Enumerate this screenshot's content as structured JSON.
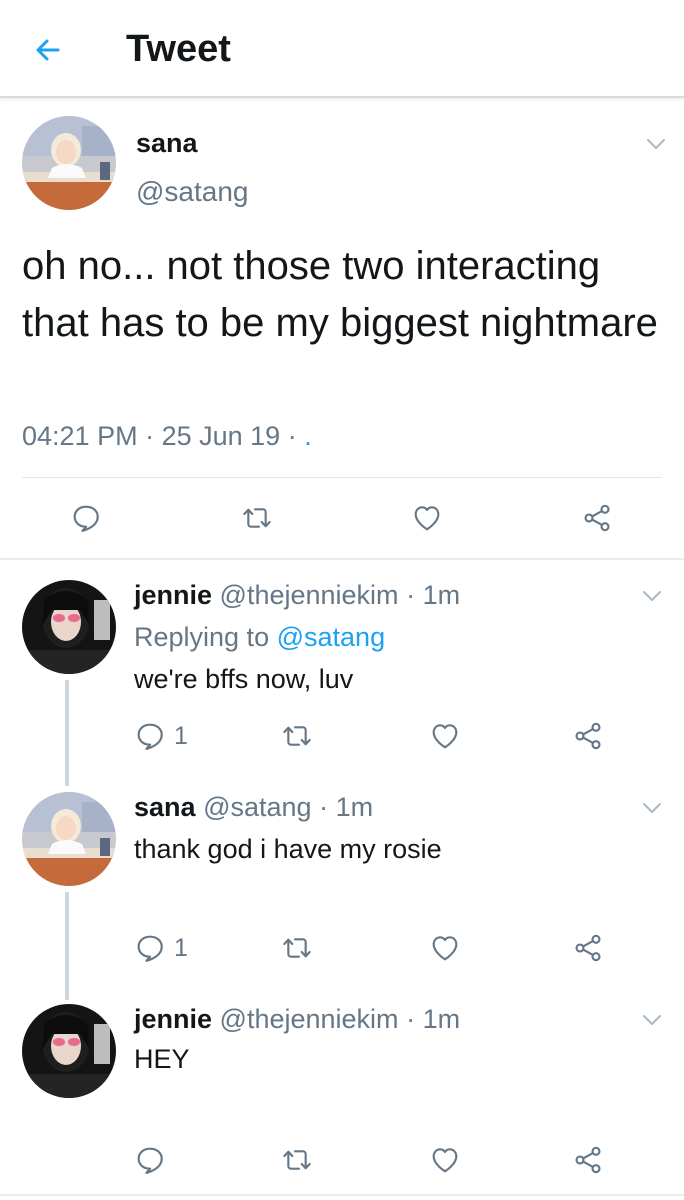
{
  "header": {
    "title": "Tweet"
  },
  "tweet": {
    "name": "sana",
    "handle": "@satang",
    "text": "oh no... not those two interacting that has to be my biggest nightmare",
    "time": "04:21 PM",
    "date": "25 Jun 19",
    "source_sep": "·",
    "source_dot": "."
  },
  "replies": [
    {
      "name": "jennie",
      "handle": "@thejenniekim",
      "time": "1m",
      "replying_prefix": "Replying to",
      "replying_to": "@satang",
      "text": "we're bffs now, luv",
      "reply_count": "1"
    },
    {
      "name": "sana",
      "handle": "@satang",
      "time": "1m",
      "text": "thank god i have my rosie",
      "reply_count": "1"
    },
    {
      "name": "jennie",
      "handle": "@thejenniekim",
      "time": "1m",
      "text": "HEY",
      "reply_count": ""
    }
  ],
  "colors": {
    "accent": "#1da1f2",
    "secondary_text": "#657786",
    "icon_gray": "#657786"
  },
  "icons": [
    "back-arrow-icon",
    "chevron-down-icon",
    "reply-icon",
    "retweet-icon",
    "like-icon",
    "share-icon"
  ]
}
